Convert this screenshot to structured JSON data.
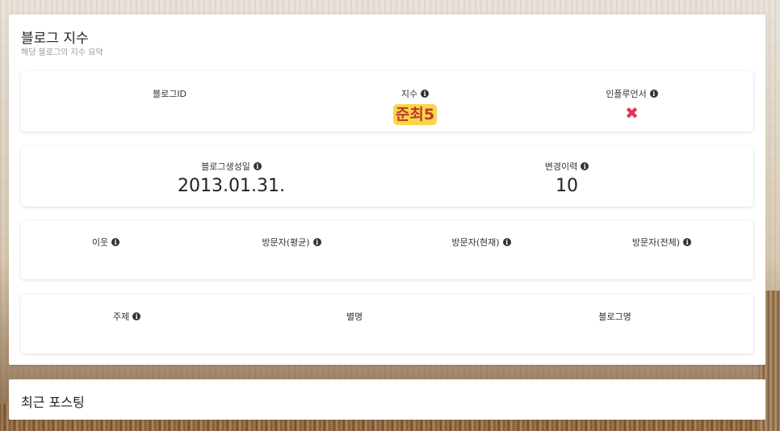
{
  "panel": {
    "title": "블로그 지수",
    "subtitle": "해당 블로그의 지수 요약"
  },
  "row1": {
    "blog_id_label": "블로그ID",
    "blog_id_value": "",
    "index_label": "지수",
    "index_value": "준최5",
    "influencer_label": "인플루언서",
    "influencer_value": "✖"
  },
  "row2": {
    "created_label": "블로그생성일",
    "created_value": "2013.01.31.",
    "changes_label": "변경이력",
    "changes_value": "10"
  },
  "row3": {
    "neighbors_label": "이웃",
    "visitors_avg_label": "방문자(평균)",
    "visitors_now_label": "방문자(현재)",
    "visitors_total_label": "방문자(전체)"
  },
  "row4": {
    "topic_label": "주제",
    "alias_label": "별명",
    "blog_name_label": "블로그명"
  },
  "recent": {
    "title": "최근 포스팅"
  },
  "colors": {
    "badge_bg": "#f7d64a",
    "badge_text": "#c0392b",
    "x_mark": "#e8325a"
  },
  "icons": {
    "info": "info-circle-icon",
    "influencer": "x-mark-icon"
  }
}
